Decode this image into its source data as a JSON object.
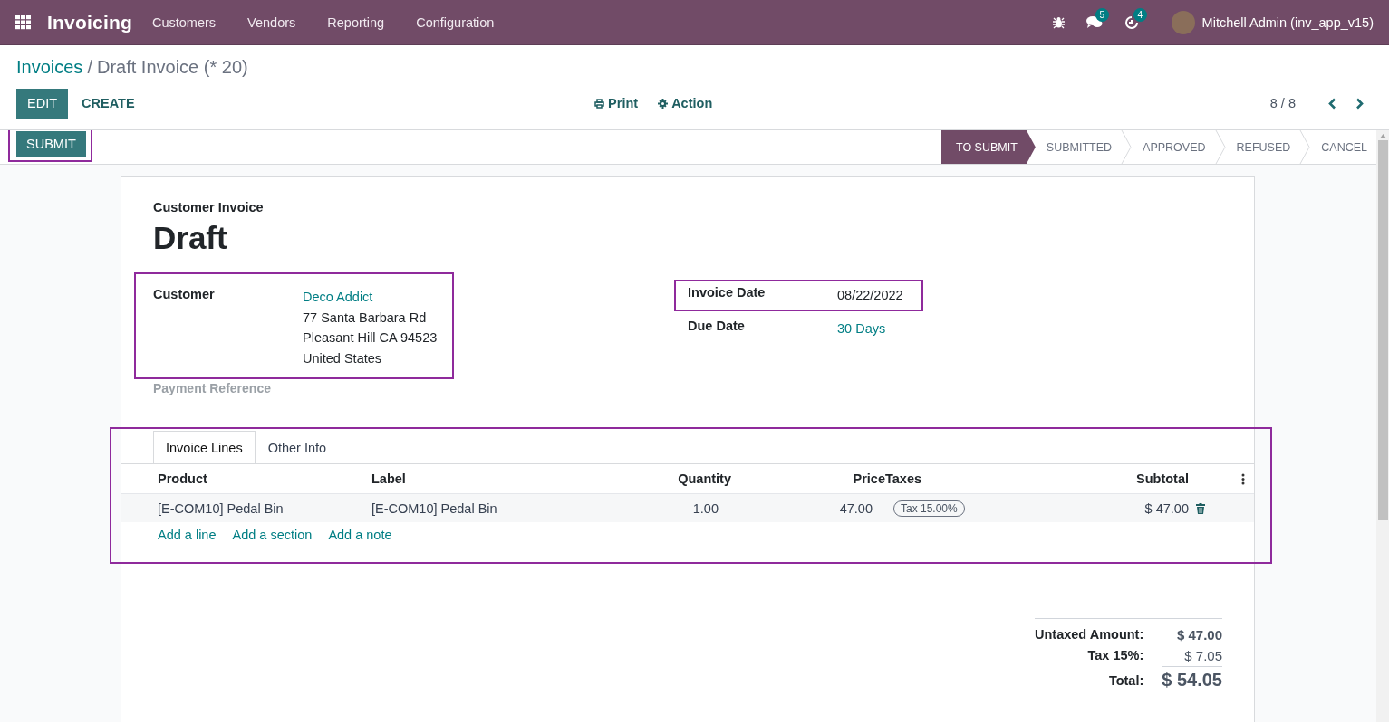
{
  "navbar": {
    "app_name": "Invoicing",
    "menu": [
      "Customers",
      "Vendors",
      "Reporting",
      "Configuration"
    ],
    "messages_badge": "5",
    "activities_badge": "4",
    "user": "Mitchell Admin (inv_app_v15)"
  },
  "breadcrumb": {
    "parent": "Invoices",
    "separator": "/",
    "current": "Draft Invoice (* 20)"
  },
  "buttons": {
    "edit": "EDIT",
    "create": "CREATE",
    "print": "Print",
    "action": "Action"
  },
  "pager": "8 / 8",
  "submit_button": {
    "label": "SUBMIT",
    "highlighted": true
  },
  "stages": [
    {
      "label": "TO SUBMIT",
      "selected": true
    },
    {
      "label": "SUBMITTED",
      "selected": false
    },
    {
      "label": "APPROVED",
      "selected": false
    },
    {
      "label": "REFUSED",
      "selected": false
    },
    {
      "label": "CANCEL",
      "selected": false
    }
  ],
  "form": {
    "type_label": "Customer Invoice",
    "name": "Draft",
    "customer": {
      "label": "Customer",
      "name": "Deco Addict",
      "address": [
        "77 Santa Barbara Rd",
        "Pleasant Hill CA 94523",
        "United States"
      ],
      "highlighted": true
    },
    "payment_reference": {
      "label": "Payment Reference"
    },
    "invoice_date": {
      "label": "Invoice Date",
      "value": "08/22/2022",
      "highlighted": true
    },
    "due_date": {
      "label": "Due Date",
      "value": "30 Days"
    }
  },
  "tabs": [
    {
      "label": "Invoice Lines",
      "selected": true
    },
    {
      "label": "Other Info",
      "selected": false
    }
  ],
  "lines": {
    "highlighted": true,
    "columns": [
      "Product",
      "Label",
      "Quantity",
      "Price",
      "Taxes",
      "Subtotal"
    ],
    "rows": [
      {
        "product": "[E-COM10] Pedal Bin",
        "label": "[E-COM10] Pedal Bin",
        "quantity": "1.00",
        "price": "47.00",
        "taxes": [
          "Tax 15.00%"
        ],
        "subtotal": "$ 47.00"
      }
    ],
    "actions": [
      "Add a line",
      "Add a section",
      "Add a note"
    ]
  },
  "totals": [
    {
      "label": "Untaxed Amount:",
      "value": "$ 47.00",
      "kind": "subtotal"
    },
    {
      "label": "Tax 15%:",
      "value": "$ 7.05",
      "kind": "tax"
    },
    {
      "label": "Total:",
      "value": "$ 54.05",
      "kind": "total"
    }
  ]
}
